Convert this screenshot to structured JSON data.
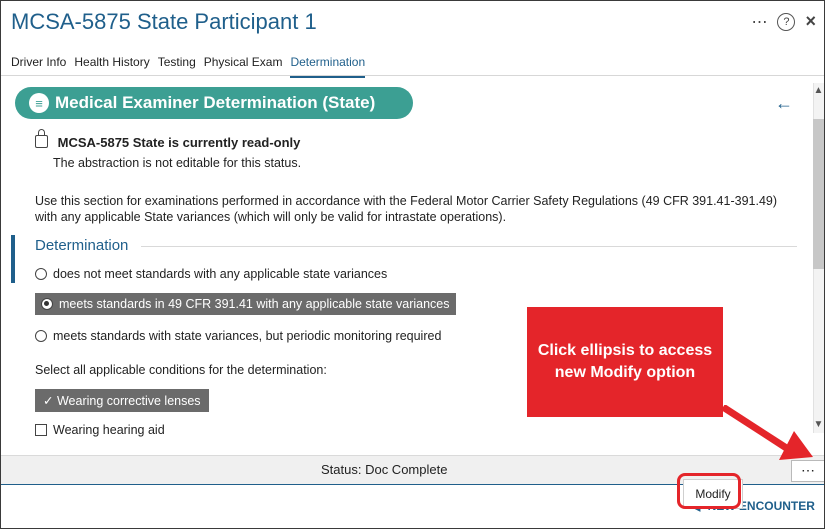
{
  "window": {
    "title": "MCSA-5875 State Participant 1",
    "icons": {
      "more": "⋯",
      "help": "?",
      "close": "×"
    }
  },
  "tabs": [
    {
      "label": "Driver Info"
    },
    {
      "label": "Health History"
    },
    {
      "label": "Testing"
    },
    {
      "label": "Physical Exam"
    },
    {
      "label": "Determination"
    }
  ],
  "panel": {
    "header": "Medical Examiner Determination (State)",
    "readonly_title": "MCSA-5875 State is currently read-only",
    "readonly_sub": "The abstraction is not editable for this status.",
    "intro": "Use this section for examinations performed in accordance with the Federal Motor Carrier Safety Regulations (49 CFR 391.41-391.49) with any applicable State variances (which will only be valid for intrastate operations).",
    "section_title": "Determination",
    "radios": [
      {
        "label": "does not meet standards with any applicable state variances"
      },
      {
        "label": "meets standards in 49 CFR 391.41 with any applicable state variances"
      },
      {
        "label": "meets standards with state variances, but periodic monitoring required"
      }
    ],
    "conditions_label": "Select all applicable conditions for the determination:",
    "chip_label": "Wearing corrective lenses",
    "checkbox_label": "Wearing hearing aid"
  },
  "footer": {
    "status": "Status: Doc Complete",
    "ellipsis": "⋯"
  },
  "menu": {
    "modify": "Modify"
  },
  "bottom": {
    "encounter": "NEW ENCOUNTER"
  },
  "callout": {
    "text": "Click ellipsis to access new Modify option"
  }
}
